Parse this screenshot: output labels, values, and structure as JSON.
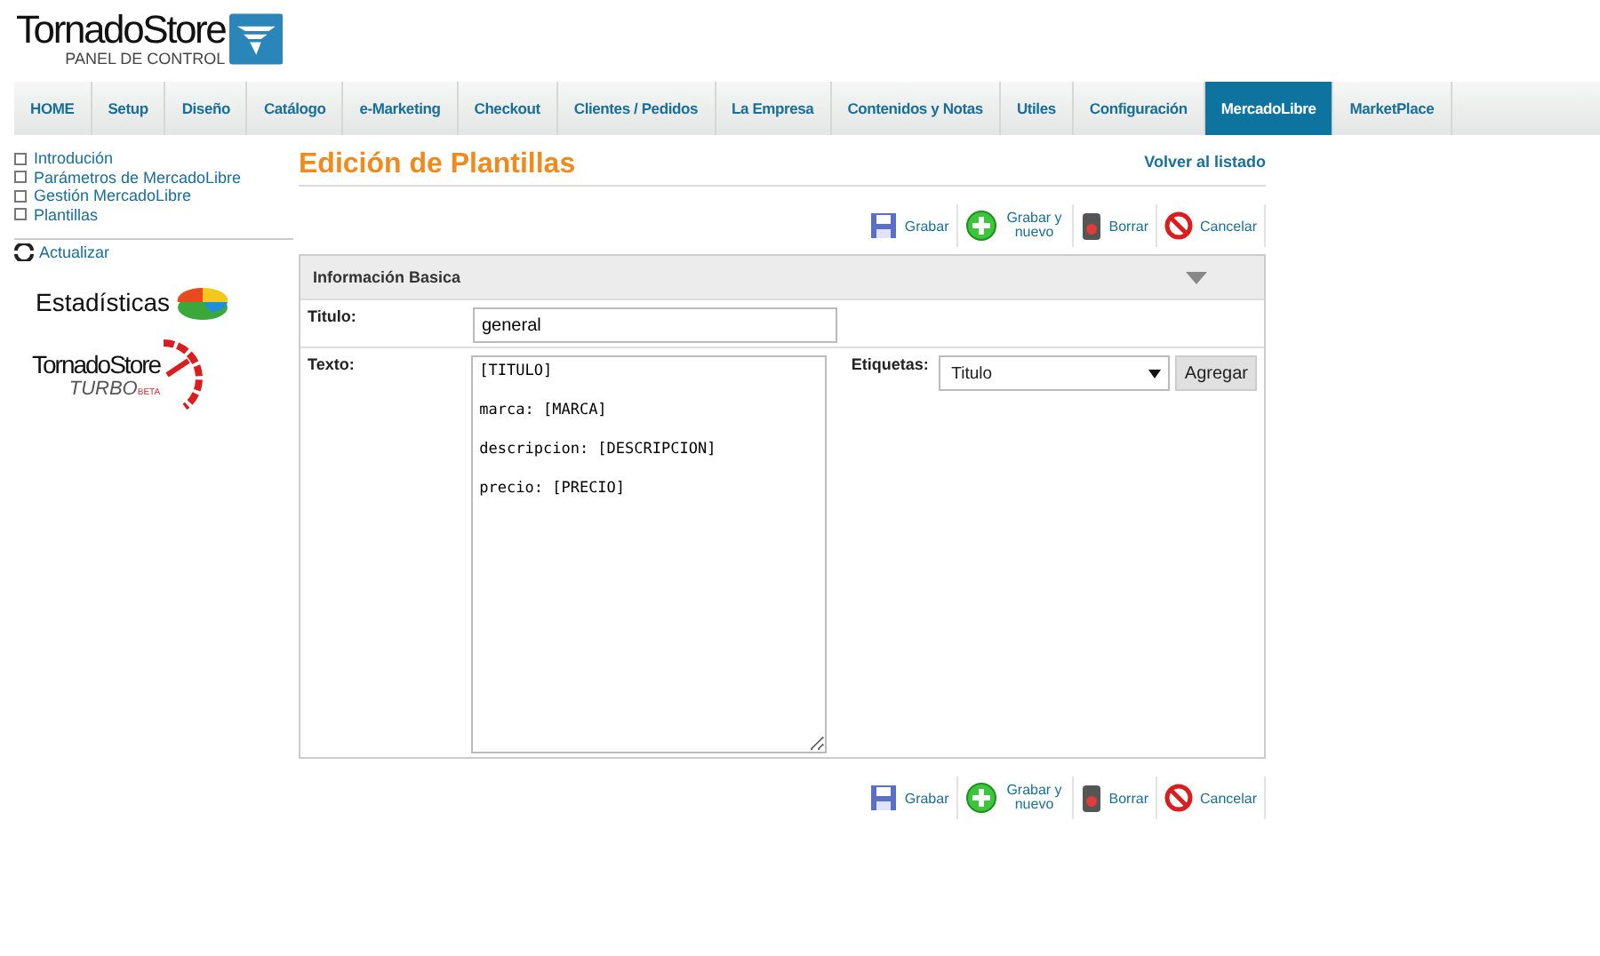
{
  "logo": {
    "name": "TornadoStore",
    "subtitle": "PANEL DE CONTROL"
  },
  "nav": [
    {
      "label": "HOME",
      "selected": false
    },
    {
      "label": "Setup",
      "selected": false
    },
    {
      "label": "Diseño",
      "selected": false
    },
    {
      "label": "Catálogo",
      "selected": false
    },
    {
      "label": "e-Marketing",
      "selected": false
    },
    {
      "label": "Checkout",
      "selected": false
    },
    {
      "label": "Clientes / Pedidos",
      "selected": false
    },
    {
      "label": "La Empresa",
      "selected": false
    },
    {
      "label": "Contenidos y Notas",
      "selected": false
    },
    {
      "label": "Utiles",
      "selected": false
    },
    {
      "label": "Configuración",
      "selected": false
    },
    {
      "label": "MercadoLibre",
      "selected": true
    },
    {
      "label": "MarketPlace",
      "selected": false
    }
  ],
  "sidebar": {
    "items": [
      "Introdución",
      "Parámetros de MercadoLibre",
      "Gestión MercadoLibre",
      "Plantillas"
    ],
    "refresh": "Actualizar",
    "stats_banner": "Estadísticas",
    "turbo_banner": {
      "name": "TornadoStore",
      "turbo": "TURBO",
      "beta": "BETA"
    }
  },
  "page": {
    "title": "Edición de Plantillas",
    "back_link": "Volver al listado"
  },
  "top_actions": [
    {
      "kind": "save",
      "label": "Grabar"
    },
    {
      "kind": "save-new",
      "label": "Grabar y nuevo"
    },
    {
      "kind": "delete",
      "label": "Borrar"
    },
    {
      "kind": "cancel",
      "label": "Cancelar"
    }
  ],
  "bottom_actions": [
    {
      "kind": "save",
      "label": "Grabar"
    },
    {
      "kind": "save-new",
      "label": "Grabar y nuevo"
    },
    {
      "kind": "delete",
      "label": "Borrar"
    },
    {
      "kind": "cancel",
      "label": "Cancelar"
    }
  ],
  "section": {
    "title": "Información Basica",
    "expanded": true,
    "title_field": {
      "label": "Titulo:",
      "value": "general"
    },
    "text_field": {
      "label": "Texto:",
      "value": "[TITULO]\n\nmarca: [MARCA]\n\ndescripcion: [DESCRIPCION]\n\nprecio: [PRECIO]"
    },
    "tags": {
      "label": "Etiquetas:",
      "value": "Titulo",
      "button": "Agregar"
    }
  }
}
